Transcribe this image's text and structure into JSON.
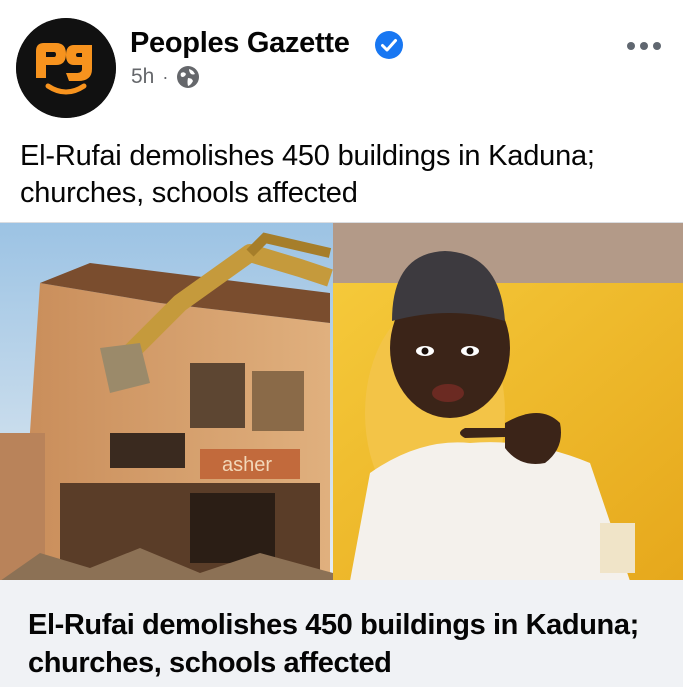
{
  "post": {
    "page_name": "Peoples Gazette",
    "time_ago": "5h",
    "separator": "·",
    "visibility_icon": "globe-icon",
    "verified_icon": "verified-badge-icon",
    "more_icon": "more-options-icon",
    "text": "El-Rufai demolishes 450 buildings in Kaduna; churches, schools affected"
  },
  "image": {
    "storefront_sign": "asher",
    "description_icon": "news-photo"
  },
  "link_preview": {
    "title": "El-Rufai demolishes 450 buildings in Kaduna; churches, schools affected"
  },
  "colors": {
    "brand_orange": "#f7931e",
    "verified_blue": "#1877f2",
    "meta_gray": "#65676b",
    "card_bg": "#f0f2f5"
  }
}
